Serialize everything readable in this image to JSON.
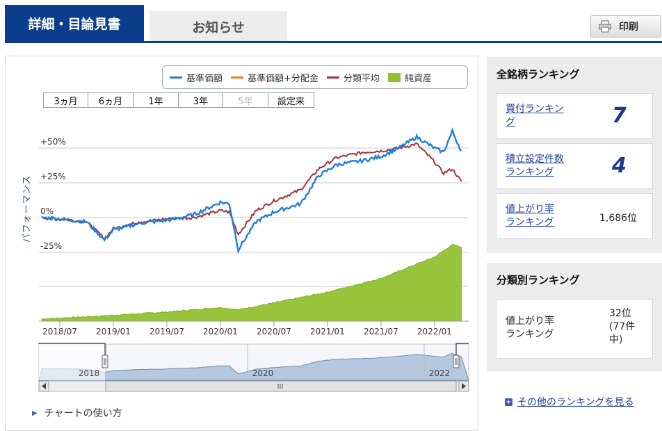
{
  "tabs": {
    "active": "詳細・目論見書",
    "inactive": "お知らせ"
  },
  "print_label": "印刷",
  "legend": [
    {
      "label": "基準価額",
      "color": "#1e7fe0",
      "type": "line"
    },
    {
      "label": "基準価額+分配金",
      "color": "#f07a1e",
      "type": "line"
    },
    {
      "label": "分類平均",
      "color": "#a8323a",
      "type": "line"
    },
    {
      "label": "純資産",
      "color": "#8fc032",
      "type": "area"
    }
  ],
  "ranges": [
    {
      "label": "3ヵ月",
      "disabled": false
    },
    {
      "label": "6ヵ月",
      "disabled": false
    },
    {
      "label": "1年",
      "disabled": false
    },
    {
      "label": "3年",
      "disabled": false
    },
    {
      "label": "5年",
      "disabled": true
    },
    {
      "label": "設定来",
      "disabled": false
    }
  ],
  "chart_data": {
    "type": "line",
    "ylabel": "パフォーマンス",
    "y_ticks": [
      "+50%",
      "+25%",
      "0%",
      "-25%"
    ],
    "y_tick_values": [
      50,
      25,
      0,
      -25
    ],
    "x_ticks": [
      "2018/07",
      "2019/01",
      "2019/07",
      "2020/01",
      "2020/07",
      "2021/01",
      "2021/07",
      "2022/01"
    ],
    "navigator_labels": [
      "2018",
      "2020",
      "2022"
    ],
    "series": [
      {
        "name": "基準価額",
        "color": "#1e7fe0",
        "x": [
          "2018/05",
          "2018/07",
          "2018/10",
          "2018/12",
          "2019/01",
          "2019/04",
          "2019/07",
          "2019/10",
          "2020/01",
          "2020/02",
          "2020/03",
          "2020/05",
          "2020/07",
          "2020/10",
          "2020/12",
          "2021/02",
          "2021/05",
          "2021/07",
          "2021/09",
          "2021/11",
          "2022/01",
          "2022/02",
          "2022/03",
          "2022/04"
        ],
        "values": [
          0,
          -1,
          -3,
          -16,
          -9,
          -4,
          -2,
          2,
          11,
          10,
          -23,
          -3,
          4,
          10,
          30,
          38,
          41,
          44,
          50,
          58,
          50,
          47,
          62,
          48
        ]
      },
      {
        "name": "分類平均",
        "color": "#a8323a",
        "x": [
          "2018/05",
          "2018/07",
          "2018/10",
          "2018/12",
          "2019/01",
          "2019/04",
          "2019/07",
          "2019/10",
          "2020/01",
          "2020/02",
          "2020/03",
          "2020/05",
          "2020/07",
          "2020/10",
          "2020/12",
          "2021/02",
          "2021/05",
          "2021/07",
          "2021/09",
          "2021/11",
          "2022/01",
          "2022/02",
          "2022/03",
          "2022/04"
        ],
        "values": [
          0,
          -1,
          -3,
          -15,
          -8,
          -3,
          -1,
          0,
          5,
          4,
          -12,
          5,
          12,
          20,
          35,
          43,
          47,
          48,
          50,
          53,
          40,
          32,
          35,
          26
        ]
      },
      {
        "name": "純資産",
        "color": "#8fc032",
        "x": [
          "2018/05",
          "2018/12",
          "2019/07",
          "2020/01",
          "2020/03",
          "2020/07",
          "2021/01",
          "2021/07",
          "2022/01",
          "2022/03",
          "2022/04"
        ],
        "values": [
          3,
          7,
          12,
          18,
          15,
          24,
          38,
          56,
          84,
          100,
          97
        ]
      }
    ]
  },
  "all_ranking": {
    "title": "全銘柄ランキング",
    "items": [
      {
        "label1": "買付ランキン",
        "label2": "グ",
        "value": "7"
      },
      {
        "label1": "積立設定件数",
        "label2": "ランキング",
        "value": "4"
      },
      {
        "label1": "値上がり率",
        "label2": "ランキング",
        "value": "1,686位"
      }
    ]
  },
  "category_ranking": {
    "title": "分類別ランキング",
    "label1": "値上がり率",
    "label2": "ランキング",
    "value1": "32位",
    "value2": "(77件",
    "value3": "中)"
  },
  "howto": "チャートの使い方",
  "more_link": "その他のランキングを見る"
}
